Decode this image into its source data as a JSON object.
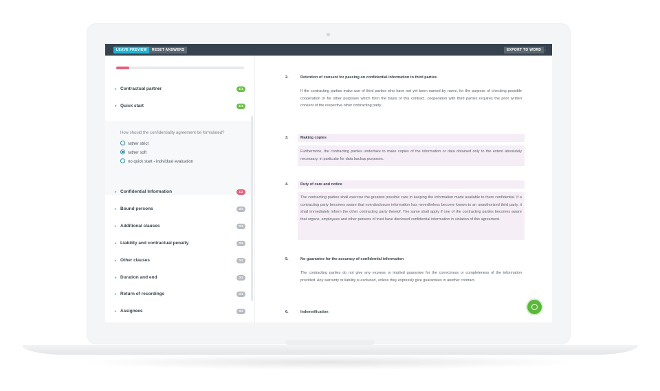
{
  "toolbar": {
    "leave_preview": "LEAVE PREVIEW",
    "reset_answers": "RESET ANSWERS",
    "export_to_word": "EXPORT TO WORD",
    "more_icon": "vertical-dots-icon"
  },
  "progress": {
    "fraction": 0.1
  },
  "sections": [
    {
      "label": "Contractual partner",
      "badge": "1/1",
      "status": "complete",
      "expanded": false
    },
    {
      "label": "Quick start",
      "badge": "1/1",
      "status": "complete",
      "expanded": true
    },
    {
      "label": "Confidential Information",
      "badge": "1/2",
      "status": "partial",
      "expanded": false
    },
    {
      "label": "Bound persons",
      "badge": "0/1",
      "status": "empty",
      "expanded": false
    },
    {
      "label": "Additional clauses",
      "badge": "0/1",
      "status": "empty",
      "expanded": false
    },
    {
      "label": "Liability and contractual penalty",
      "badge": "0/3",
      "status": "empty",
      "expanded": false
    },
    {
      "label": "Other clauses",
      "badge": "0/1",
      "status": "empty",
      "expanded": false
    },
    {
      "label": "Duration and end",
      "badge": "0/2",
      "status": "empty",
      "expanded": false
    },
    {
      "label": "Return of recordings",
      "badge": "0/1",
      "status": "empty",
      "expanded": false
    },
    {
      "label": "Assignees",
      "badge": "0/1",
      "status": "empty",
      "expanded": false
    }
  ],
  "quick_start": {
    "question": "How should the confidentiality agreement be formulated?",
    "options": [
      "rather strict",
      "rather soft",
      "no quick start - individual evaluation"
    ],
    "selected_index": 1
  },
  "document": [
    {
      "num": "2.",
      "title": "Retention of consent for passing on confidential information to third parties",
      "body": "If the contracting parties make use of third parties who have not yet been named by name, for the purpose of checking possible cooperation or for other purposes which form the basis of this contract, cooperation with third parties requires the prior written consent of the respective other contracting party.",
      "highlighted": false
    },
    {
      "num": "3.",
      "title": "Making copies",
      "body": "Furthermore, the contracting parties undertake to make copies of the information or data obtained only to the extent absolutely necessary, in particular for data backup purposes.",
      "highlighted": true
    },
    {
      "num": "4.",
      "title": "Duty of care and notice",
      "body": "The contracting parties shall exercise the greatest possible care in keeping the information made available to them confidential. If a contracting party becomes aware that non-disclosure information has nevertheless become known to an unauthorized third party, it shall immediately inform the other contracting party thereof. The same shall apply if one of the contracting parties becomes aware that organs, employees and other persons of trust have disclosed confidential information in violation of this agreement.",
      "highlighted": true
    },
    {
      "num": "5.",
      "title": "No guarantee for the accuracy of confidential information",
      "body": "The contracting parties do not give any express or implied guarantee for the correctness or completeness of the information provided. Any warranty or liability is excluded, unless they expressly give guarantees in another contract.",
      "highlighted": false
    },
    {
      "num": "6.",
      "title": "Indemnification",
      "body": "",
      "highlighted": false
    }
  ],
  "chat": {
    "icon": "chat-icon"
  },
  "colors": {
    "toolbar": "#36424d",
    "accent": "#1fb5d4",
    "complete": "#6cc04a",
    "partial": "#e5607a",
    "empty": "#b5bbc1"
  }
}
